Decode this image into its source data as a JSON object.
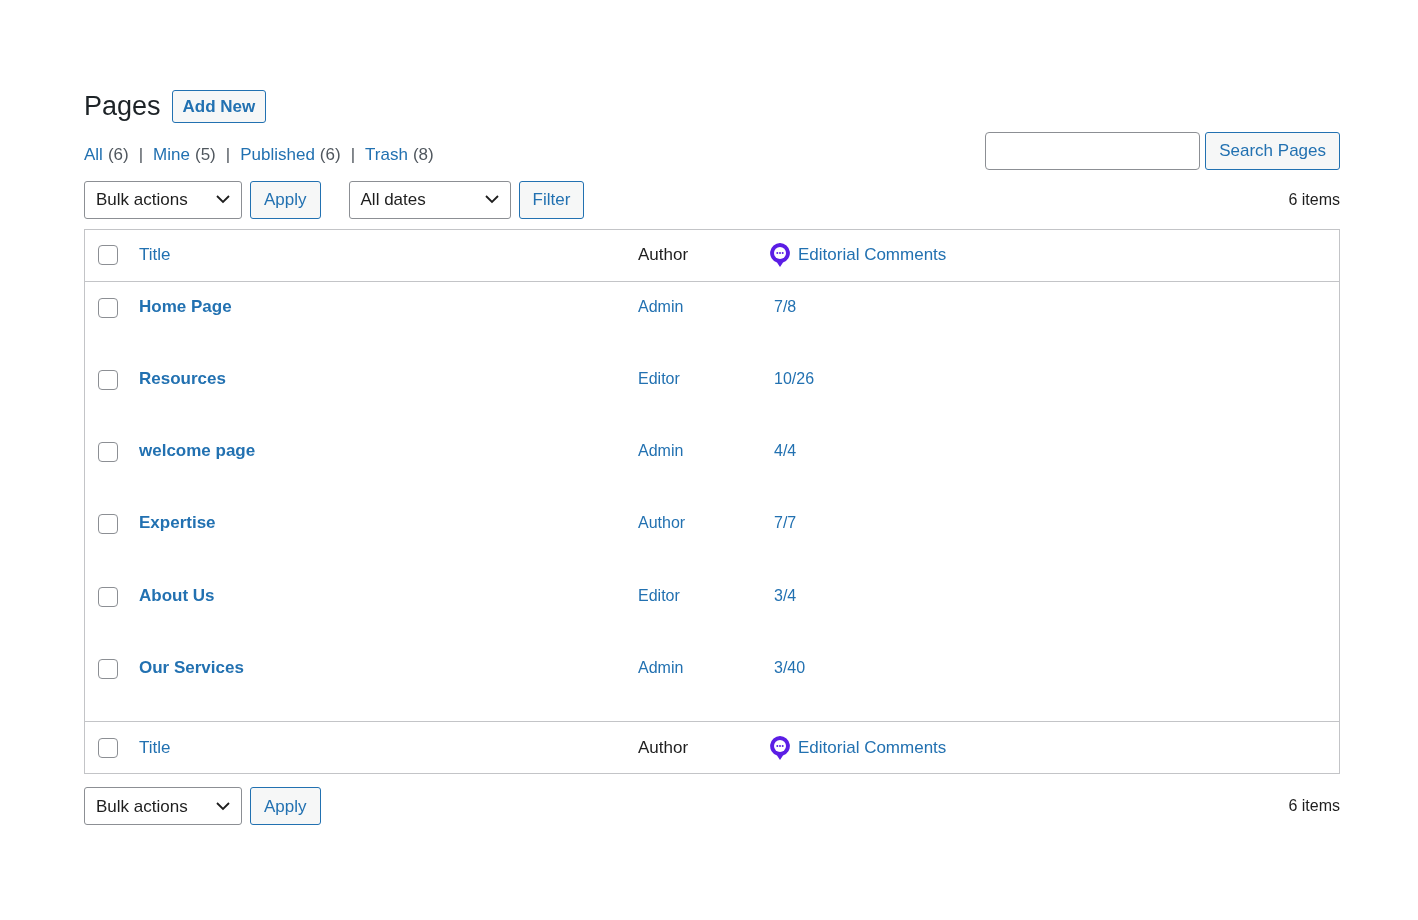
{
  "heading": "Pages",
  "add_new": "Add New",
  "views": [
    {
      "label": "All",
      "count": "(6)",
      "selected": false
    },
    {
      "separator": "|",
      "label": "Mine",
      "count": "(5)",
      "selected": false
    },
    {
      "separator": "|",
      "label": "Published",
      "count": "(6)",
      "selected": false
    },
    {
      "separator": "|",
      "label": "Trash",
      "count": "(8)",
      "selected": false
    }
  ],
  "search": {
    "button": "Search Pages"
  },
  "top_nav": {
    "bulk_actions": "Bulk actions",
    "apply": "Apply",
    "dates": "All dates",
    "filter": "Filter",
    "items": "6 items"
  },
  "table": {
    "header": {
      "checked": false,
      "title": "Title",
      "author": "Author",
      "comments": "Editorial Comments"
    },
    "rows": [
      {
        "checked": false,
        "title": "Home Page",
        "author": "Admin",
        "comments": "7/8"
      },
      {
        "checked": false,
        "title": "Resources",
        "author": "Editor",
        "comments": "10/26"
      },
      {
        "checked": false,
        "title": "welcome page",
        "author": "Admin",
        "comments": "4/4"
      },
      {
        "checked": false,
        "title": "Expertise",
        "author": "Author",
        "comments": "7/7"
      },
      {
        "checked": false,
        "title": "About Us",
        "author": "Editor",
        "comments": "3/4"
      },
      {
        "checked": false,
        "title": "Our Services",
        "author": "Admin",
        "comments": "3/40"
      }
    ],
    "footer": {
      "checked": false,
      "title": "Title",
      "author": "Author",
      "comments": "Editorial Comments"
    }
  },
  "bottom_nav": {
    "bulk_actions": "Bulk actions",
    "apply": "Apply",
    "items": "6 items"
  }
}
